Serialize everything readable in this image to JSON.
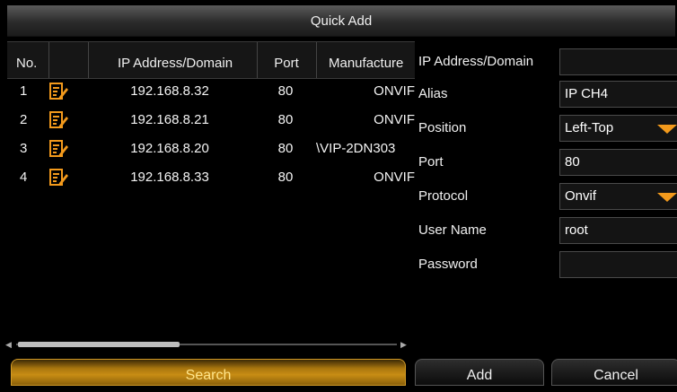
{
  "dialog": {
    "title": "Quick Add"
  },
  "table": {
    "headers": {
      "no": "No.",
      "ip": "IP Address/Domain",
      "port": "Port",
      "manufacturer": "Manufacture"
    },
    "rows": [
      {
        "no": "1",
        "ip": "192.168.8.32",
        "port": "80",
        "manufacturer": "ONVIF",
        "icon": "edit-icon"
      },
      {
        "no": "2",
        "ip": "192.168.8.21",
        "port": "80",
        "manufacturer": "ONVIF",
        "icon": "edit-icon"
      },
      {
        "no": "3",
        "ip": "192.168.8.20",
        "port": "80",
        "manufacturer": "\\VIP-2DN303",
        "icon": "edit-icon"
      },
      {
        "no": "4",
        "ip": "192.168.8.33",
        "port": "80",
        "manufacturer": "ONVIF",
        "icon": "edit-icon"
      }
    ]
  },
  "form": {
    "ip_label": "IP Address/Domain",
    "ip_value": "",
    "alias_label": "Alias",
    "alias_value": "IP CH4",
    "position_label": "Position",
    "position_value": "Left-Top",
    "port_label": "Port",
    "port_value": "80",
    "protocol_label": "Protocol",
    "protocol_value": "Onvif",
    "username_label": "User Name",
    "username_value": "root",
    "password_label": "Password",
    "password_value": ""
  },
  "buttons": {
    "search": "Search",
    "add": "Add",
    "cancel": "Cancel"
  },
  "colors": {
    "accent": "#f39a1c",
    "search_button": "#c88d14",
    "background": "#000000"
  }
}
